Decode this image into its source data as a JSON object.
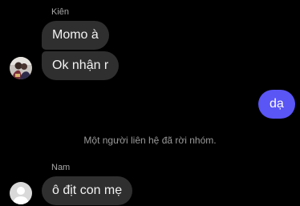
{
  "colors": {
    "background": "#000000",
    "incoming_bubble": "#2f2f2f",
    "outgoing_bubble": "#5a55f5",
    "muted_text": "#a8a8a8"
  },
  "thread": {
    "group1": {
      "sender": "Kiên",
      "avatar_icon": "photo-avatar",
      "messages": [
        "Momo à",
        "Ok nhận r"
      ]
    },
    "outgoing": {
      "messages": [
        "dạ"
      ]
    },
    "system_notice": "Một người liên hệ đã rời nhóm.",
    "group2": {
      "sender": "Nam",
      "avatar_icon": "default-user-avatar",
      "messages": [
        "ô địt con mẹ"
      ]
    }
  }
}
